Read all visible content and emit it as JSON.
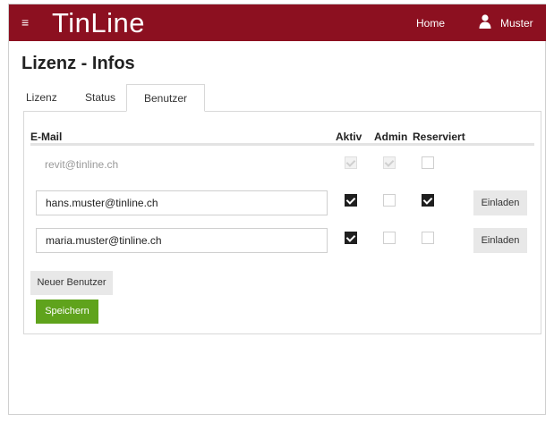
{
  "app": {
    "brand": "TinLine",
    "menu_icon": "hamburger-menu-icon",
    "nav": {
      "home": "Home",
      "user": "Muster",
      "user_icon": "user-icon"
    },
    "colors": {
      "navbar": "#8c1020",
      "save_button": "#5fa31c",
      "checkbox_checked": "#1f1f1f"
    }
  },
  "page": {
    "title": "Lizenz - Infos"
  },
  "tabs": [
    {
      "label": "Lizenz",
      "active": false
    },
    {
      "label": "Status",
      "active": false
    },
    {
      "label": "Benutzer",
      "active": true
    }
  ],
  "table": {
    "headers": {
      "email": "E-Mail",
      "aktiv": "Aktiv",
      "admin": "Admin",
      "reserviert": "Reserviert"
    },
    "rows": [
      {
        "email": "revit@tinline.ch",
        "editable": false,
        "aktiv": true,
        "admin": true,
        "reserviert": false,
        "disabled": true
      },
      {
        "email": "hans.muster@tinline.ch",
        "editable": true,
        "aktiv": true,
        "admin": false,
        "reserviert": true,
        "invite_label": "Einladen"
      },
      {
        "email": "maria.muster@tinline.ch",
        "editable": true,
        "aktiv": true,
        "admin": false,
        "reserviert": false,
        "invite_label": "Einladen"
      }
    ]
  },
  "actions": {
    "new_user": "Neuer Benutzer",
    "save": "Speichern"
  }
}
